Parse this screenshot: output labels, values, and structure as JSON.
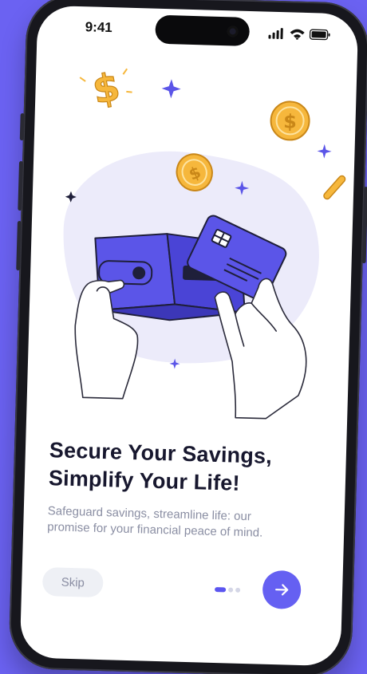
{
  "status_bar": {
    "time": "9:41"
  },
  "onboarding": {
    "headline_line1": "Secure Your Savings,",
    "headline_line2": "Simplify Your Life!",
    "subtext_line1": "Safeguard savings, streamline life: our",
    "subtext_line2": "promise for your financial peace of mind.",
    "skip_label": "Skip",
    "page_count": 3,
    "current_page": 1
  },
  "icons": {
    "next": "arrow-right-icon",
    "signal": "signal-icon",
    "wifi": "wifi-icon",
    "battery": "battery-icon"
  },
  "colors": {
    "background": "#6b62f2",
    "accent": "#6560f2",
    "wallet": "#5b55e8",
    "coin": "#f6b73c",
    "headline": "#17172e",
    "body": "#8a8ea3"
  }
}
